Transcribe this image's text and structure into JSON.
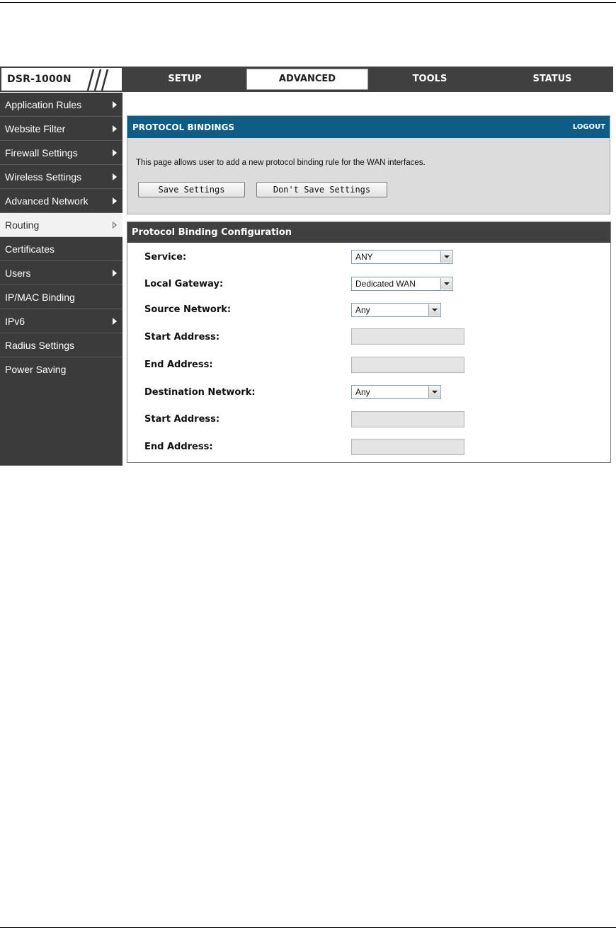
{
  "brand": "DSR-1000N",
  "tabs": [
    {
      "label": "SETUP"
    },
    {
      "label": "ADVANCED"
    },
    {
      "label": "TOOLS"
    },
    {
      "label": "STATUS"
    }
  ],
  "active_tab": "ADVANCED",
  "sidebar": {
    "items": [
      {
        "label": "Application Rules",
        "has_arrow": true
      },
      {
        "label": "Website Filter",
        "has_arrow": true
      },
      {
        "label": "Firewall Settings",
        "has_arrow": true
      },
      {
        "label": "Wireless Settings",
        "has_arrow": true
      },
      {
        "label": "Advanced Network",
        "has_arrow": true
      },
      {
        "label": "Routing",
        "has_arrow": true
      },
      {
        "label": "Certificates",
        "has_arrow": false
      },
      {
        "label": "Users",
        "has_arrow": true
      },
      {
        "label": "IP/MAC Binding",
        "has_arrow": false
      },
      {
        "label": "IPv6",
        "has_arrow": true
      },
      {
        "label": "Radius Settings",
        "has_arrow": false
      },
      {
        "label": "Power Saving",
        "has_arrow": false
      }
    ],
    "active_item": "Routing"
  },
  "bindings_panel": {
    "title": "PROTOCOL BINDINGS",
    "logout": "LOGOUT",
    "description": "This page allows user to add a new protocol binding rule for the WAN interfaces.",
    "save_label": "Save Settings",
    "dont_save_label": "Don't Save Settings"
  },
  "config": {
    "title": "Protocol Binding Configuration",
    "service_label": "Service:",
    "service_value": "ANY",
    "gateway_label": "Local Gateway:",
    "gateway_value": "Dedicated WAN",
    "source_label": "Source Network:",
    "source_value": "Any",
    "source_start_label": "Start Address:",
    "source_start_value": "",
    "source_end_label": "End Address:",
    "source_end_value": "",
    "dest_label": "Destination Network:",
    "dest_value": "Any",
    "dest_start_label": "Start Address:",
    "dest_start_value": "",
    "dest_end_label": "End Address:",
    "dest_end_value": ""
  },
  "colors": {
    "nav_bg": "#404040",
    "panel_header": "#0f5c87",
    "panel_bg": "#dcdcdc",
    "disabled_input": "#e4e4e4"
  }
}
